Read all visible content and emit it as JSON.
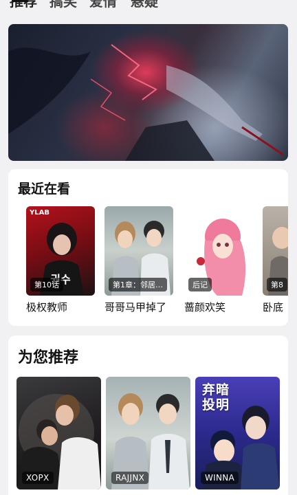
{
  "tabs": [
    {
      "label": "推荐"
    },
    {
      "label": "搞笑"
    },
    {
      "label": "爱情"
    },
    {
      "label": "悬疑"
    }
  ],
  "recent": {
    "title": "最近在看",
    "items": [
      {
        "title": "极权教师",
        "badge": "第10话",
        "logo": "YLAB",
        "cover_text": "권수"
      },
      {
        "title": "哥哥马甲掉了",
        "badge": "第1章：邻居…"
      },
      {
        "title": "蔷颜欢笑",
        "badge": "后记"
      },
      {
        "title": "卧底",
        "badge": "第8"
      }
    ]
  },
  "recommend": {
    "title": "为您推荐",
    "items": [
      {
        "tag": "XOPX"
      },
      {
        "tag": "RAJJNX"
      },
      {
        "tag": "WINNA",
        "cover_title_line1": "弃暗",
        "cover_title_line2": "投明"
      }
    ]
  }
}
